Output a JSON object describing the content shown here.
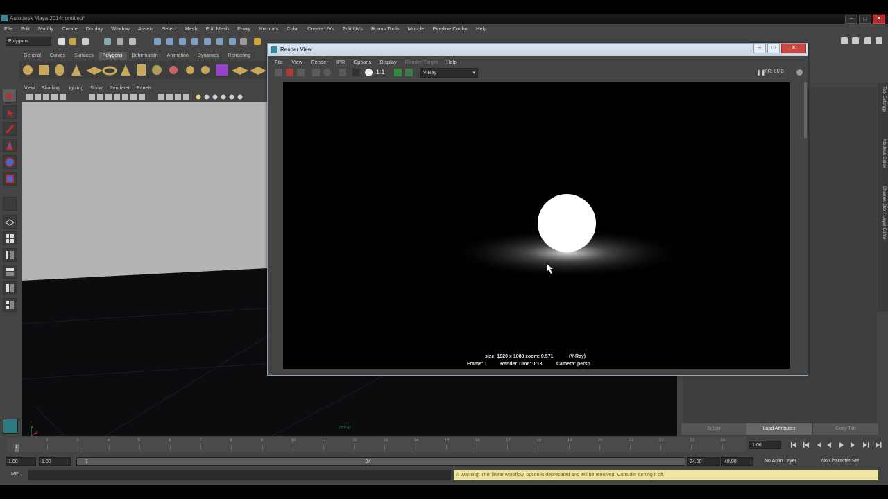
{
  "maya": {
    "title": "Autodesk Maya 2014: untitled*",
    "menus": [
      "File",
      "Edit",
      "Modify",
      "Create",
      "Display",
      "Window",
      "Assets",
      "Select",
      "Mesh",
      "Edit Mesh",
      "Proxy",
      "Normals",
      "Color",
      "Create UVs",
      "Edit UVs",
      "Bonus Tools",
      "Muscle",
      "Pipeline Cache",
      "Help"
    ],
    "menuset": "Polygons",
    "shelf_tabs": [
      "General",
      "Curves",
      "Surfaces",
      "Polygons",
      "Deformation",
      "Animation",
      "Dynamics",
      "Rendering"
    ],
    "active_shelf_tab": "Polygons",
    "panel_menus": [
      "View",
      "Shading",
      "Lighting",
      "Show",
      "Renderer",
      "Panels"
    ],
    "viewport_label": "persp",
    "axis": {
      "x": "x",
      "y": "y"
    }
  },
  "render_view": {
    "title": "Render View",
    "menus": [
      "File",
      "View",
      "Render",
      "IPR",
      "Options",
      "Display",
      "Render Target",
      "Help"
    ],
    "disabled_menu": "Render Target",
    "zoom_label": "1:1",
    "renderer": "V-Ray",
    "ipr_status": "IPR: 0MB",
    "info_line1_size": "size: 1920 x 1080 zoom: 0.571",
    "info_line1_renderer": "(V-Ray)",
    "info_line2_frame": "Frame: 1",
    "info_line2_time": "Render Time: 0:13",
    "info_line2_camera": "Camera: persp"
  },
  "attribute_editor": {
    "buttons": [
      "Select",
      "Load Attributes",
      "Copy Tab"
    ],
    "side_tabs": [
      "Tool Settings",
      "Attribute Editor",
      "Channel Box / Layer Editor"
    ]
  },
  "time_slider": {
    "ticks": [
      "1",
      "2",
      "3",
      "4",
      "5",
      "6",
      "7",
      "8",
      "9",
      "10",
      "11",
      "12",
      "13",
      "14",
      "15",
      "16",
      "17",
      "18",
      "19",
      "20",
      "21",
      "22",
      "23",
      "24"
    ],
    "current_frame": "1",
    "current_time_field": "1.00"
  },
  "range_slider": {
    "start_time": "1.00",
    "playback_start": "1.00",
    "range_start": "1",
    "range_end": "24",
    "playback_end": "24.00",
    "end_time": "48.00",
    "anim_layer": "No Anim Layer",
    "character_set": "No Character Set"
  },
  "command_line": {
    "label": "MEL",
    "warning": "// Warning: The 'linear workflow' option is deprecated and will be removed. Consider turning it off."
  }
}
